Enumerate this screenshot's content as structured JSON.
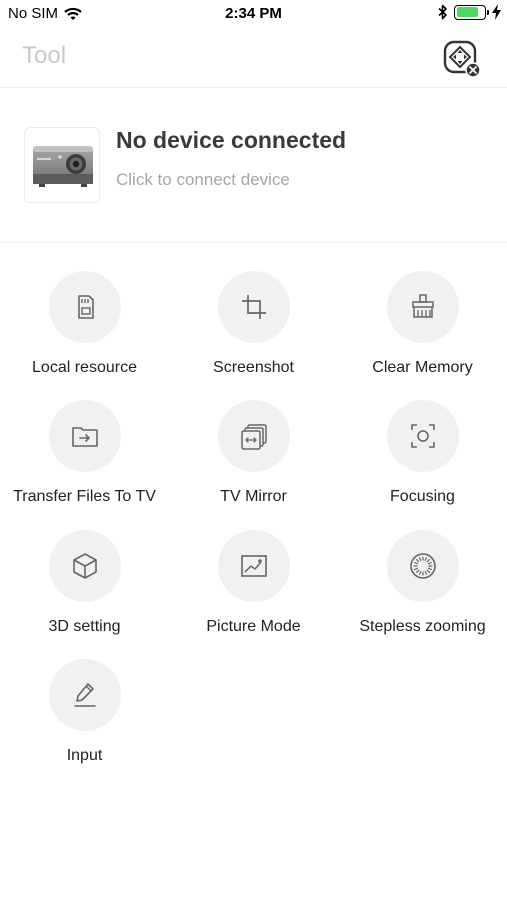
{
  "status_bar": {
    "carrier": "No SIM",
    "time": "2:34 PM",
    "battery_level": 0.8,
    "icons": [
      "wifi-icon",
      "bluetooth-icon",
      "battery-icon",
      "charging-icon"
    ]
  },
  "header": {
    "title": "Tool",
    "action_icon": "remote-disconnected-icon"
  },
  "device": {
    "title": "No device connected",
    "subtitle": "Click to connect device",
    "icon": "projector-icon"
  },
  "tools": [
    {
      "label": "Local resource",
      "icon": "sd-card-icon"
    },
    {
      "label": "Screenshot",
      "icon": "crop-icon"
    },
    {
      "label": "Clear Memory",
      "icon": "broom-icon"
    },
    {
      "label": "Transfer Files To TV",
      "icon": "folder-transfer-icon"
    },
    {
      "label": "TV Mirror",
      "icon": "mirror-icon"
    },
    {
      "label": "Focusing",
      "icon": "focus-icon"
    },
    {
      "label": "3D setting",
      "icon": "cube-icon"
    },
    {
      "label": "Picture Mode",
      "icon": "picture-icon"
    },
    {
      "label": "Stepless zooming",
      "icon": "zoom-dial-icon"
    },
    {
      "label": "Input",
      "icon": "pen-icon"
    }
  ],
  "colors": {
    "icon_circle": "#f1f1f1",
    "icon_stroke": "#666666",
    "title_muted": "#c8c8c8",
    "battery": "#4cd964"
  }
}
